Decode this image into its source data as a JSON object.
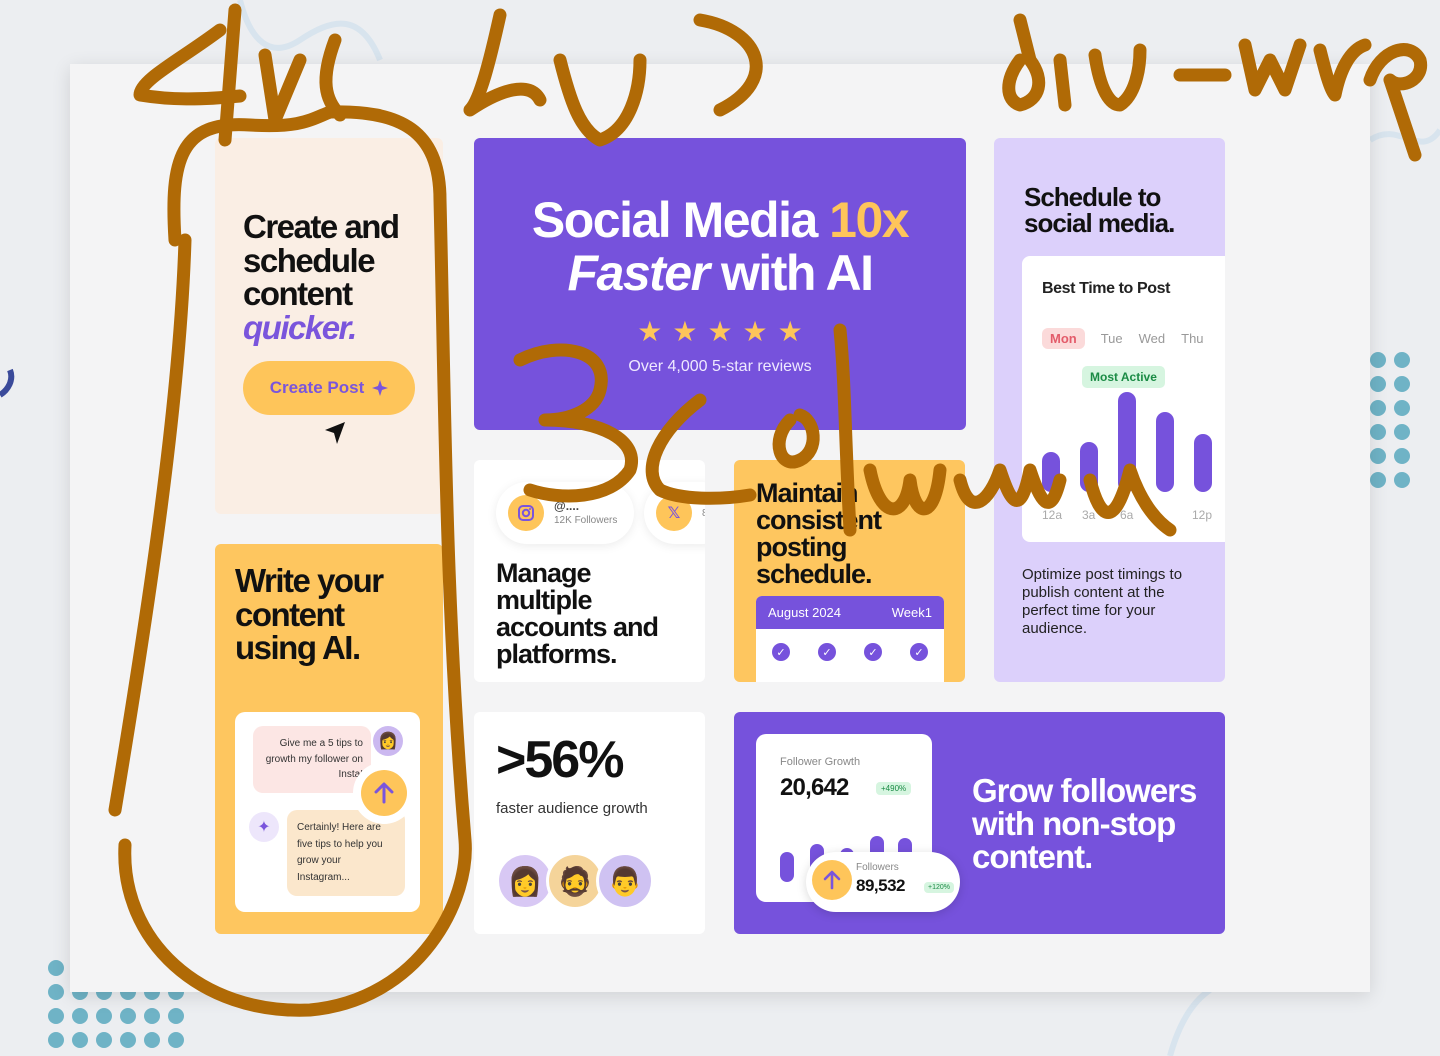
{
  "colors": {
    "primary_purple": "#7652dc",
    "accent_yellow": "#fec55a",
    "peach": "#faeee4",
    "lavender": "#dcd0fb",
    "annotation_brown": "#b06a06"
  },
  "create_card": {
    "heading_lines": [
      "Create and",
      "schedule",
      "content"
    ],
    "heading_accent": "quicker.",
    "button_label": "Create Post",
    "button_icon": "sparkle-icon"
  },
  "ai_card": {
    "heading_lines": [
      "Write your",
      "content",
      "using AI."
    ],
    "question": "Give me a 5 tips to growth my follower on Insta!",
    "answer": "Certainly! Here are five tips to help you grow your Instagram..."
  },
  "hero": {
    "title_part1": "Social Media ",
    "title_accent": "10x",
    "title_italic": "Faster",
    "title_part2": " with AI",
    "rating": 5,
    "reviews": "Over 4,000 5-star reviews"
  },
  "accounts_card": {
    "accounts": [
      {
        "icon": "instagram-icon",
        "handle": "@....",
        "followers": "12K Followers"
      },
      {
        "icon": "x-icon",
        "handle": "",
        "followers": "8"
      }
    ],
    "heading_lines": [
      "Manage",
      "multiple",
      "accounts and",
      "platforms."
    ]
  },
  "consistent_card": {
    "heading_lines": [
      "Maintain",
      "consistent",
      "posting",
      "schedule."
    ],
    "calendar_month": "August 2024",
    "calendar_week": "Week1"
  },
  "schedule_card": {
    "heading_lines": [
      "Schedule to",
      "social media."
    ],
    "panel_title": "Best Time to Post",
    "days": [
      "Mon",
      "Tue",
      "Wed",
      "Thu"
    ],
    "selected_day": "Mon",
    "badge": "Most Active",
    "time_labels": [
      "12a",
      "3a",
      "6a",
      "12p"
    ],
    "description": "Optimize post timings to publish content at the perfect time for your audience."
  },
  "growth_card": {
    "stat": ">56%",
    "caption": "faster audience growth"
  },
  "followers_card": {
    "growth_label": "Follower Growth",
    "growth_value": "20,642",
    "growth_badge": "+490%",
    "followers_label": "Followers",
    "followers_value": "89,532",
    "followers_badge": "+120%",
    "heading_lines": [
      "Grow followers",
      "with non-stop",
      "content."
    ]
  },
  "annotations": {
    "top_left": "div div div )",
    "top_right": "div-wrap",
    "middle": "3 column"
  }
}
